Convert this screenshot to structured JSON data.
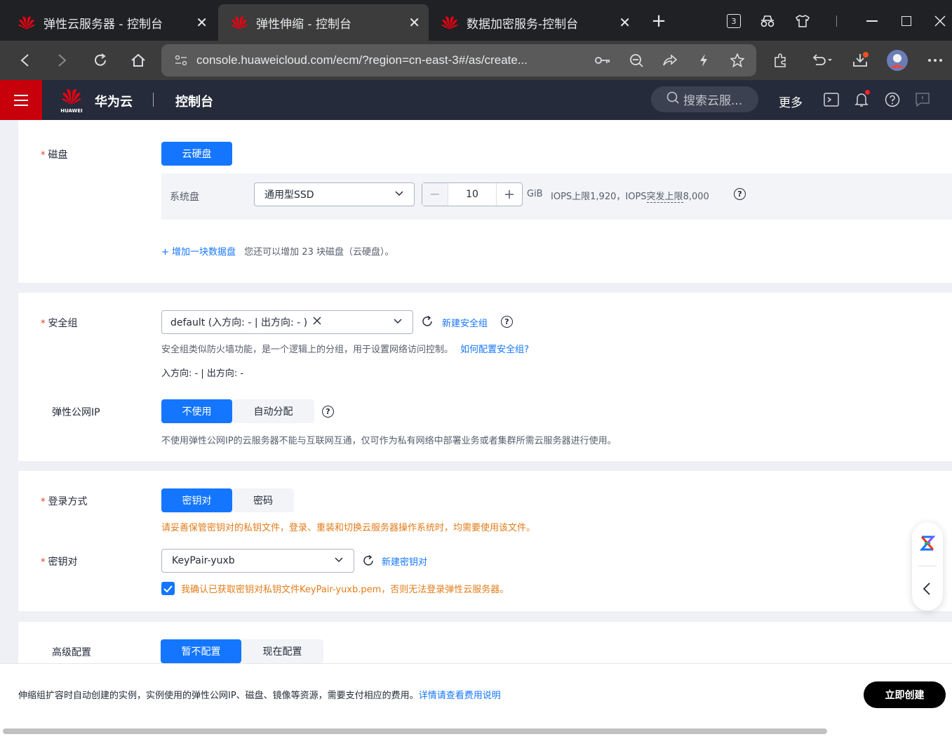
{
  "browser": {
    "tabs": [
      {
        "title": "弹性云服务器 - 控制台",
        "active": false
      },
      {
        "title": "弹性伸缩 - 控制台",
        "active": true
      },
      {
        "title": "数据加密服务-控制台",
        "active": false
      }
    ],
    "close_glyph": "✕",
    "new_tab_glyph": "+",
    "tab_count": "3",
    "url": "console.huaweicloud.com/ecm/?region=cn-east-3#/as/create..."
  },
  "header": {
    "brand_small": "HUAWEI",
    "brand": "华为云",
    "title": "控制台",
    "search_placeholder": "搜索云服...",
    "more": "更多",
    "colors": {
      "brand_red": "#c7000b",
      "bar_bg": "#252b3a"
    }
  },
  "disk": {
    "label": "磁盘",
    "type_button": "云硬盘",
    "system_disk_label": "系统盘",
    "disk_type": "通用型SSD",
    "size_value": "10",
    "unit": "GiB",
    "iops_text_a": "IOPS上限1,920，IOPS",
    "iops_text_b": "突发上限",
    "iops_text_c": "8,000",
    "add_link": "+ 增加一块数据盘",
    "add_hint": "您还可以增加 23 块磁盘（云硬盘）。"
  },
  "security": {
    "label": "安全组",
    "selected": "default (入方向: - | 出方向: - )",
    "new_link": "新建安全组",
    "desc": "安全组类似防火墙功能，是一个逻辑上的分组，用于设置网络访问控制。",
    "howto_link": "如何配置安全组?",
    "rule_summary": "入方向: -  | 出方向: -"
  },
  "eip": {
    "label": "弹性公网IP",
    "options": [
      "不使用",
      "自动分配"
    ],
    "selected": "不使用",
    "desc": "不使用弹性公网IP的云服务器不能与互联网互通，仅可作为私有网络中部署业务或者集群所需云服务器进行使用。"
  },
  "login": {
    "label": "登录方式",
    "options": [
      "密钥对",
      "密码"
    ],
    "selected": "密钥对",
    "warning": "请妥善保管密钥对的私钥文件，登录、重装和切换云服务器操作系统时，均需要使用该文件。",
    "keypair_label": "密钥对",
    "keypair_value": "KeyPair-yuxb",
    "new_keypair_link": "新建密钥对",
    "confirm_checked": true,
    "confirm_text": "我确认已获取密钥对私钥文件KeyPair-yuxb.pem，否则无法登录弹性云服务器。"
  },
  "advanced": {
    "label": "高级配置",
    "options": [
      "暂不配置",
      "现在配置"
    ],
    "selected": "暂不配置"
  },
  "footer": {
    "notice": "伸缩组扩容时自动创建的实例，实例使用的弹性公网IP、磁盘、镜像等资源，需要支付相应的费用。",
    "fee_link": "详情请查看费用说明",
    "create_button": "立即创建"
  },
  "colors": {
    "primary": "#1476ff",
    "warning": "#e37c19",
    "required": "#e8381c"
  }
}
